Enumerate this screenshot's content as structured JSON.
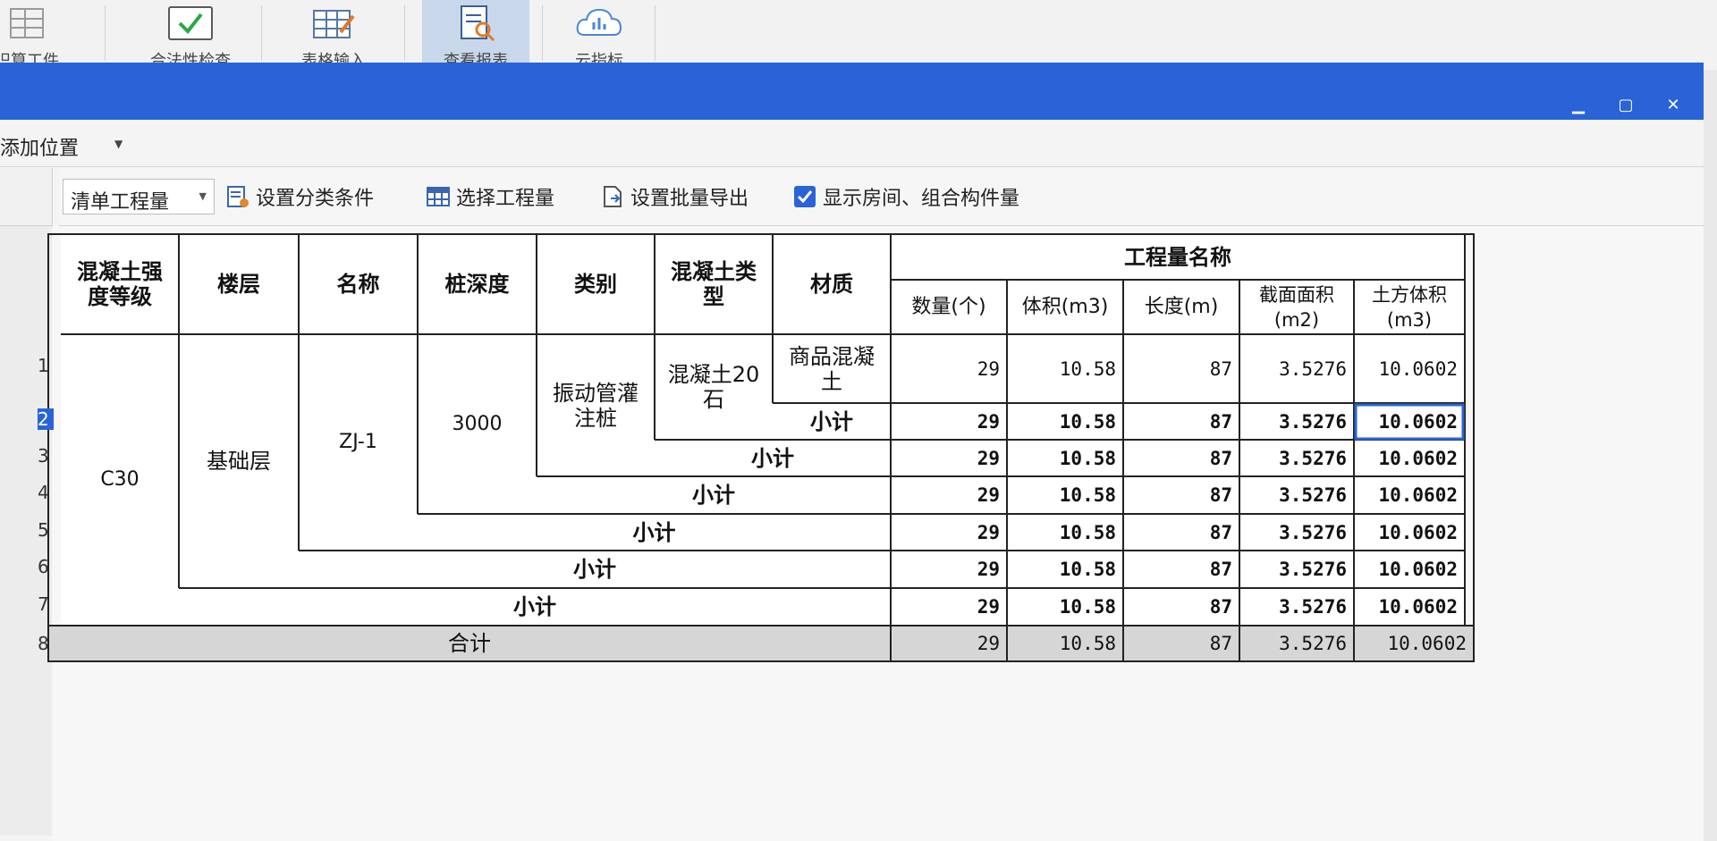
{
  "ribbon": {
    "buttons": [
      {
        "label": "识算工件"
      },
      {
        "label": "合法性检查"
      },
      {
        "label": "表格输入"
      },
      {
        "label": "查看报表"
      },
      {
        "label": "云指标"
      }
    ]
  },
  "window": {
    "controls": {
      "minimize": "▁",
      "maximize": "▢",
      "close": "✕"
    }
  },
  "menubar": {
    "add_position": "添加位置"
  },
  "toolbar": {
    "dropdown_value": "清单工程量",
    "set_classification": "设置分类条件",
    "select_quantity": "选择工程量",
    "set_batch_export": "设置批量导出",
    "show_rooms": "显示房间、组合构件量",
    "show_rooms_checked": true
  },
  "table": {
    "headers": {
      "strength": "混凝土强度等级",
      "floor": "楼层",
      "name": "名称",
      "depth": "桩深度",
      "category": "类别",
      "concrete_type": "混凝土类型",
      "material": "材质",
      "quantity_group": "工程量名称",
      "qty": "数量(个)",
      "volume": "体积(m3)",
      "length": "长度(m)",
      "section_area": "截面面积(m2)",
      "earth_volume": "土方体积(m3)"
    },
    "row_numbers": [
      "1",
      "2",
      "3",
      "4",
      "5",
      "6",
      "7",
      "8"
    ],
    "group": {
      "strength": "C30",
      "floor": "基础层",
      "name": "ZJ-1",
      "depth": "3000",
      "category": "振动管灌注桩",
      "concrete_type": "混凝土20石",
      "material": "商品混凝土"
    },
    "subtotal_label": "小计",
    "total_label": "合计",
    "rows": [
      {
        "qty": "29",
        "volume": "10.58",
        "length": "87",
        "section_area": "3.5276",
        "earth_volume": "10.0602"
      },
      {
        "qty": "29",
        "volume": "10.58",
        "length": "87",
        "section_area": "3.5276",
        "earth_volume": "10.0602"
      },
      {
        "qty": "29",
        "volume": "10.58",
        "length": "87",
        "section_area": "3.5276",
        "earth_volume": "10.0602"
      },
      {
        "qty": "29",
        "volume": "10.58",
        "length": "87",
        "section_area": "3.5276",
        "earth_volume": "10.0602"
      },
      {
        "qty": "29",
        "volume": "10.58",
        "length": "87",
        "section_area": "3.5276",
        "earth_volume": "10.0602"
      },
      {
        "qty": "29",
        "volume": "10.58",
        "length": "87",
        "section_area": "3.5276",
        "earth_volume": "10.0602"
      },
      {
        "qty": "29",
        "volume": "10.58",
        "length": "87",
        "section_area": "3.5276",
        "earth_volume": "10.0602"
      },
      {
        "qty": "29",
        "volume": "10.58",
        "length": "87",
        "section_area": "3.5276",
        "earth_volume": "10.0602"
      }
    ]
  },
  "colors": {
    "titlebar": "#2a63d8",
    "selection": "#2a63d8",
    "total_row": "#d6d6d6"
  }
}
